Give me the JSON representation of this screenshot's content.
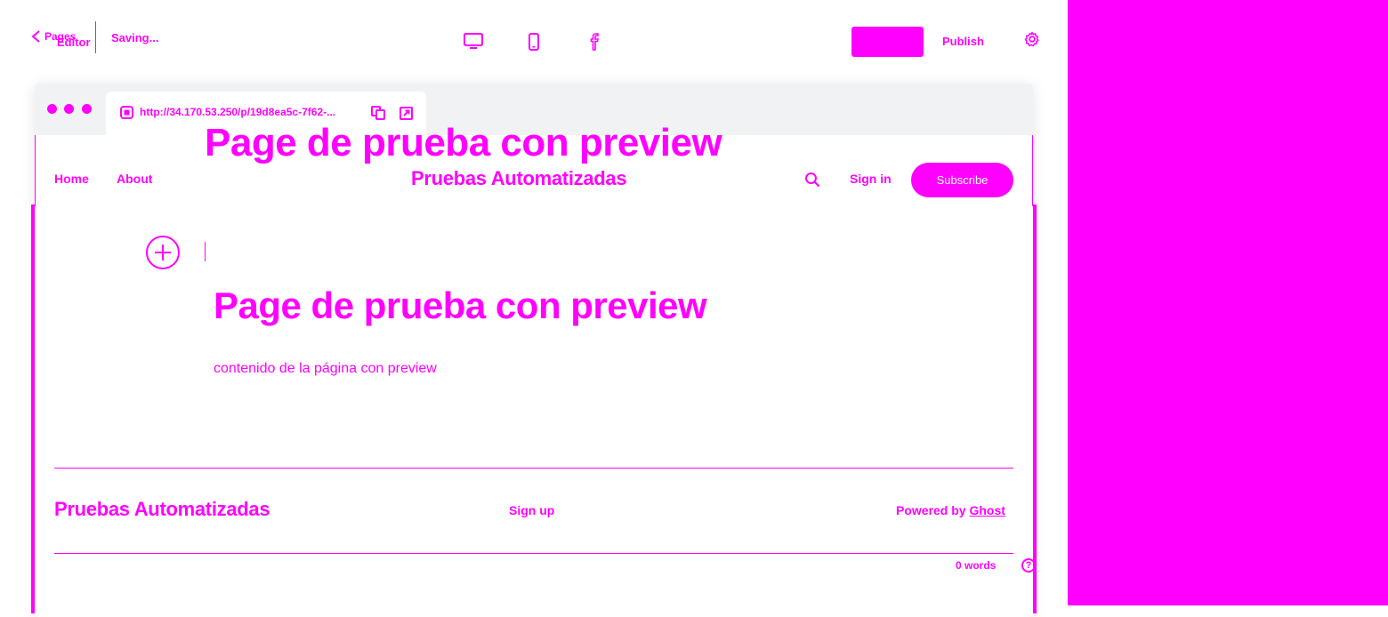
{
  "colors": {
    "accent": "#ff00ff",
    "background": "#ffffff",
    "chrome": "#f1f2f4"
  },
  "topbar": {
    "back_label": "Pages",
    "editor_label": "Editor",
    "status": "Saving...",
    "publish_label": "Publish",
    "preview_label": ""
  },
  "browser": {
    "url": "http://34.170.53.250/p/19d8ea5c-7f62-..."
  },
  "site": {
    "nav": {
      "home": "Home",
      "about": "About"
    },
    "title": "Pruebas Automatizadas",
    "sign_in": "Sign in",
    "subscribe": "Subscribe"
  },
  "overlay_title": "Page de prueba con preview",
  "post": {
    "title": "Page de prueba con preview",
    "body": "contenido de la página con preview"
  },
  "footer": {
    "title": "Pruebas Automatizadas",
    "signup": "Sign up",
    "powered_prefix": "Powered by ",
    "powered_link": "Ghost"
  },
  "status_bar": {
    "word_count": "0 words",
    "help_glyph": "?"
  },
  "icons": [
    "chevron-left-icon",
    "desktop-icon",
    "mobile-icon",
    "facebook-icon",
    "settings-icon",
    "lock-icon",
    "copy-icon",
    "external-link-icon",
    "search-icon",
    "plus-icon",
    "help-icon"
  ]
}
